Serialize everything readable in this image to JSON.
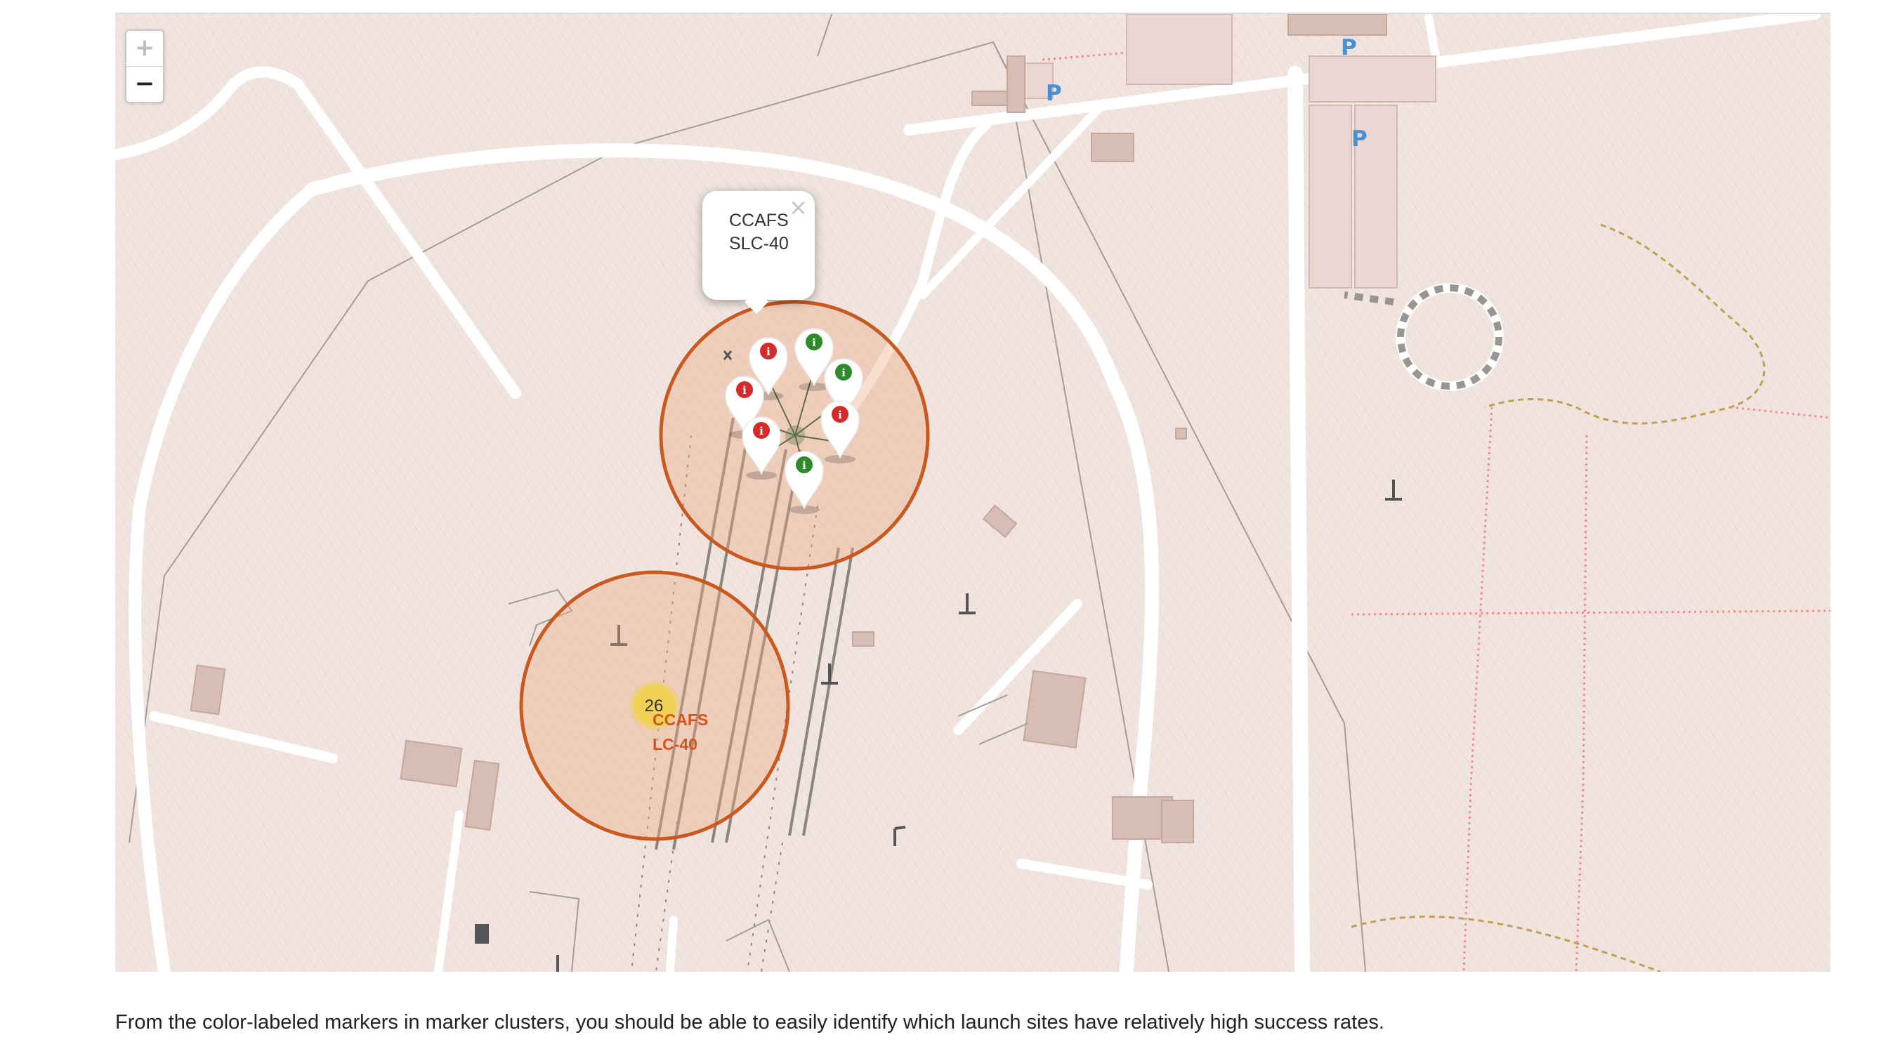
{
  "map": {
    "zoom_in_label": "+",
    "zoom_out_label": "−",
    "popup": {
      "text": "CCAFS SLC-40",
      "close_label": "×"
    },
    "cluster": {
      "count": "26"
    },
    "site_label": "CCAFS LC-40",
    "parking_labels": [
      "P",
      "P",
      "P"
    ],
    "markers": [
      {
        "outcome": "failure",
        "color": "#d62b2b",
        "icon": "info-icon"
      },
      {
        "outcome": "success",
        "color": "#2f8a2a",
        "icon": "info-icon"
      },
      {
        "outcome": "success",
        "color": "#2f8a2a",
        "icon": "info-icon"
      },
      {
        "outcome": "failure",
        "color": "#d62b2b",
        "icon": "info-icon"
      },
      {
        "outcome": "failure",
        "color": "#d62b2b",
        "icon": "info-icon"
      },
      {
        "outcome": "failure",
        "color": "#d62b2b",
        "icon": "info-icon"
      },
      {
        "outcome": "success",
        "color": "#2f8a2a",
        "icon": "info-icon"
      }
    ],
    "colors": {
      "circle_stroke": "#c9591e",
      "circle_fill": "#e9a882",
      "cluster_fill": "#f0d24a",
      "success": "#2f8a2a",
      "failure": "#d62b2b",
      "parking": "#4a90d0"
    }
  },
  "caption": "From the color-labeled markers in marker clusters, you should be able to easily identify which launch sites have relatively high success rates."
}
